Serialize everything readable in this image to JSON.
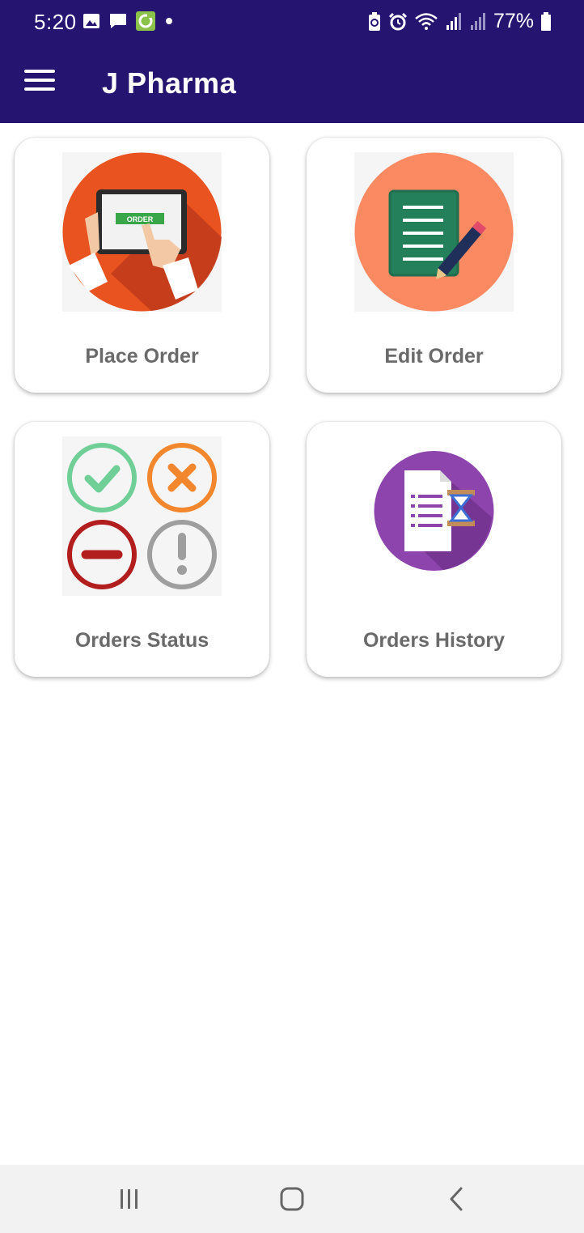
{
  "status_bar": {
    "time": "5:20",
    "battery": "77%",
    "left_icons": [
      "gallery-icon",
      "message-icon",
      "sync-app-icon",
      "notification-dot"
    ],
    "right_icons": [
      "battery-saver-icon",
      "alarm-icon",
      "wifi-icon",
      "signal-icon",
      "signal-icon-2",
      "battery-icon"
    ]
  },
  "app_bar": {
    "title": "J Pharma",
    "menu_icon": "hamburger-menu-icon",
    "color": "#261570"
  },
  "cards": [
    {
      "label": "Place Order",
      "icon": "place-order-icon",
      "badge_text": "ORDER"
    },
    {
      "label": "Edit Order",
      "icon": "edit-order-icon"
    },
    {
      "label": "Orders Status",
      "icon": "orders-status-icon"
    },
    {
      "label": "Orders History",
      "icon": "orders-history-icon"
    }
  ],
  "nav_bar": {
    "buttons": [
      "recent-apps-icon",
      "home-icon",
      "back-icon"
    ]
  }
}
